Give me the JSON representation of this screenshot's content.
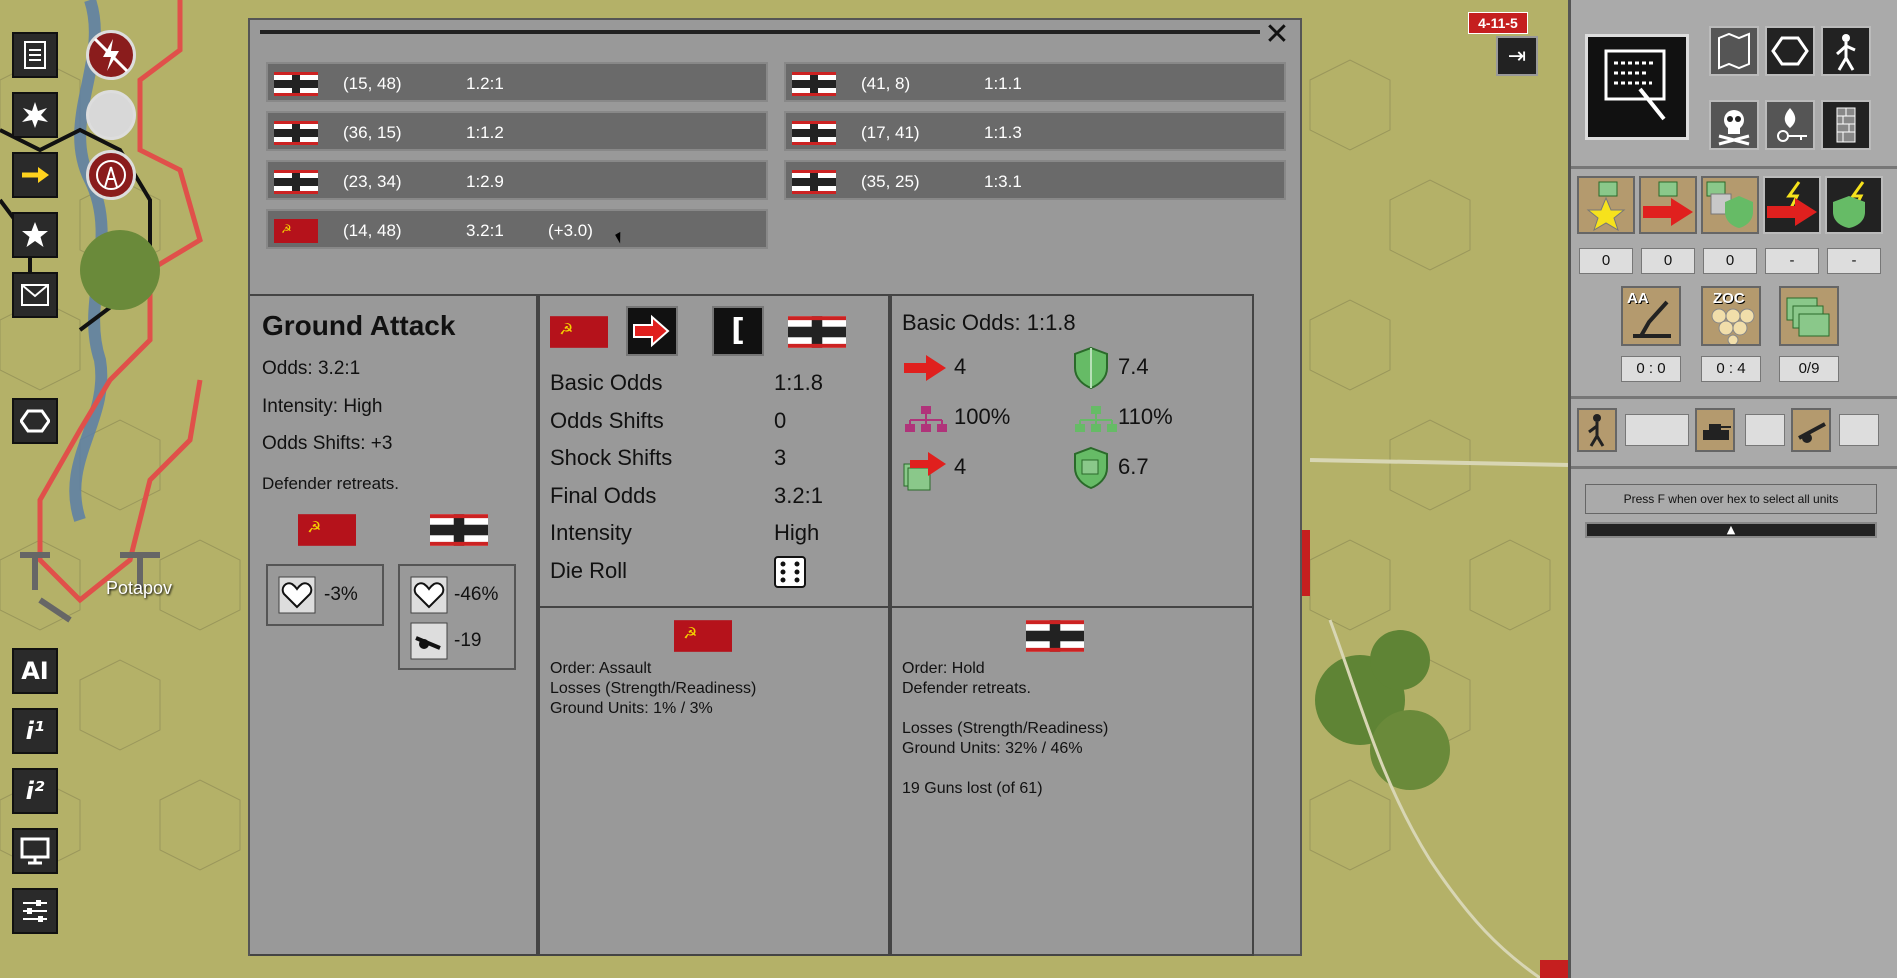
{
  "map": {
    "town_label": "Potapov"
  },
  "unit_badge": "4-11-5",
  "close_symbol": "✕",
  "rows_left": [
    {
      "coord": "(15, 48)",
      "odds": "1.2:1",
      "bonus": "",
      "side": "german"
    },
    {
      "coord": "(36, 15)",
      "odds": "1:1.2",
      "bonus": "",
      "side": "german"
    },
    {
      "coord": "(23, 34)",
      "odds": "1:2.9",
      "bonus": "",
      "side": "german"
    },
    {
      "coord": "(14, 48)",
      "odds": "3.2:1",
      "bonus": "(+3.0)",
      "side": "soviet"
    }
  ],
  "rows_right": [
    {
      "coord": "(41, 8)",
      "odds": "1:1.1",
      "side": "german"
    },
    {
      "coord": "(17, 41)",
      "odds": "1:1.3",
      "side": "german"
    },
    {
      "coord": "(35, 25)",
      "odds": "1:3.1",
      "side": "german"
    }
  ],
  "summary": {
    "title": "Ground Attack",
    "odds": "Odds: 3.2:1",
    "intensity": "Intensity: High",
    "shifts": "Odds Shifts: +3",
    "result": "Defender retreats.",
    "attacker_readiness": "-3%",
    "defender_readiness": "-46%",
    "defender_guns": "-19"
  },
  "calc": {
    "labels": [
      "Basic Odds",
      "Odds Shifts",
      "Shock Shifts",
      "Final Odds",
      "Intensity",
      "Die Roll"
    ],
    "values": [
      "1:1.8",
      "0",
      "3",
      "3.2:1",
      "High",
      ""
    ],
    "bracket": "["
  },
  "stats": {
    "basic_odds": "Basic Odds: 1:1.8",
    "attack": "4",
    "defense": "7.4",
    "att_org": "100%",
    "def_org": "110%",
    "att_supply": "4",
    "def_supply": "6.7"
  },
  "attacker_report": {
    "order": "Order: Assault",
    "losses": "Losses (Strength/Readiness)",
    "ground": "Ground Units: 1% / 3%"
  },
  "defender_report": {
    "order": "Order: Hold",
    "result": "Defender retreats.",
    "losses": "Losses (Strength/Readiness)",
    "ground": "Ground Units: 32% / 46%",
    "guns": "19 Guns lost (of 61)"
  },
  "sidebar": {
    "counters": [
      "0",
      "0",
      "0",
      "-",
      "-"
    ],
    "aa_label": "AA",
    "zoc_label": "ZOC",
    "ratios": [
      "0 : 0",
      "0 : 4",
      "0/9"
    ],
    "hint": "Press F when over hex to select all units",
    "arrow": "▲"
  },
  "left_toolbar": {
    "ai_label": "AI",
    "info1": "i¹",
    "info2": "i²"
  },
  "colors": {
    "soviet_red": "#b5121b",
    "attack_red": "#e0201e",
    "defense_green": "#66bb66",
    "org_magenta": "#b0337a",
    "panel_grey": "#999999"
  }
}
